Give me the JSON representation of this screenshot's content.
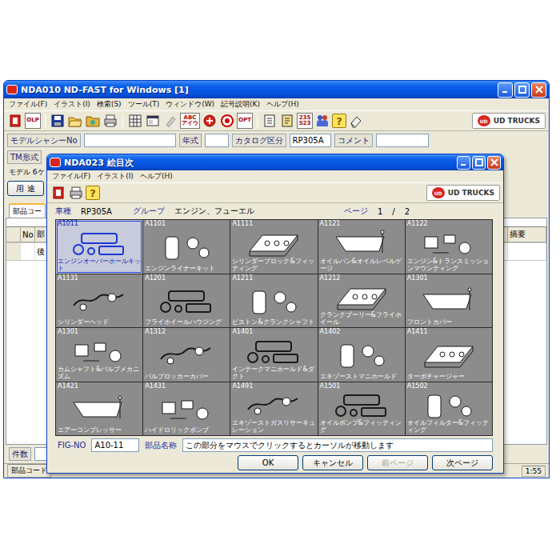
{
  "main_window": {
    "title": "NDA010 ND-FAST for Windows [1]",
    "menu": [
      "ファイル(F)",
      "イラスト(I)",
      "検索(S)",
      "ツール(T)",
      "ウィンドウ(W)",
      "記号説明(K)",
      "ヘルプ(H)"
    ],
    "toolbar": [
      {
        "kind": "icon"
      },
      {
        "kind": "text",
        "lines": [
          "OLP"
        ]
      },
      {
        "kind": "sep"
      },
      {
        "kind": "icon"
      },
      {
        "kind": "icon"
      },
      {
        "kind": "icon"
      },
      {
        "kind": "icon"
      },
      {
        "kind": "sep"
      },
      {
        "kind": "icon"
      },
      {
        "kind": "icon"
      },
      {
        "kind": "icon"
      },
      {
        "kind": "text",
        "lines": [
          "ABC",
          "アイウ"
        ]
      },
      {
        "kind": "icon"
      },
      {
        "kind": "icon"
      },
      {
        "kind": "text",
        "lines": [
          "OPT"
        ]
      },
      {
        "kind": "sep"
      },
      {
        "kind": "icon"
      },
      {
        "kind": "icon"
      },
      {
        "kind": "text",
        "lines": [
          "235",
          "523"
        ]
      },
      {
        "kind": "icon"
      },
      {
        "kind": "glyph",
        "lines": [
          "?"
        ]
      },
      {
        "kind": "icon"
      }
    ],
    "logo": {
      "mark": "UD",
      "text": "UD TRUCKS"
    },
    "fields": [
      {
        "label": "モデルシャシーNo",
        "value": ""
      },
      {
        "label": "年式",
        "value": ""
      },
      {
        "label": "カタログ区分",
        "value": "RP305A"
      },
      {
        "label": "コメント",
        "value": ""
      }
    ],
    "tm_label": "TM形式",
    "model_label": "モデル 6ケ",
    "use_button": "用 途",
    "tabs": [
      {
        "label": "部品コー",
        "selected": true
      }
    ],
    "table": {
      "columns": [
        "No",
        "部",
        "摘要"
      ],
      "rows": [
        [
          "",
          "後",
          ""
        ]
      ]
    },
    "count_label": "件数",
    "status_bar": {
      "left": "部品コード",
      "right": "1:55"
    }
  },
  "dialog": {
    "title": "NDA023 絵目次",
    "menu": [
      "ファイル(F)",
      "イラスト(I)",
      "ヘルプ(H)"
    ],
    "toolbar": [
      {
        "kind": "icon"
      },
      {
        "kind": "icon"
      },
      {
        "kind": "glyph",
        "lines": [
          "?"
        ]
      }
    ],
    "logo": {
      "mark": "UD",
      "text": "UD TRUCKS"
    },
    "info": {
      "model_label": "車種",
      "model": "RP305A",
      "group_label": "グループ",
      "group": "エンジン、フューエル",
      "page_label": "ページ",
      "page": "1",
      "separator": "/",
      "pages": "2"
    },
    "cells": [
      {
        "code": "A1011",
        "label": "エンジンオーバーホールキット",
        "selected": true
      },
      {
        "code": "A1101",
        "label": "エンジンライナーキット",
        "selected": false
      },
      {
        "code": "A1111",
        "label": "シリンダーブロック&フィッティング",
        "selected": false
      },
      {
        "code": "A1121",
        "label": "オイルパン&オイルレベルゲージ",
        "selected": false
      },
      {
        "code": "A1122",
        "label": "エンジン&トランスミッションマウンティング",
        "selected": false
      },
      {
        "code": "A1131",
        "label": "シリンダーヘッド",
        "selected": false
      },
      {
        "code": "A1201",
        "label": "フライホイールハウジング",
        "selected": false
      },
      {
        "code": "A1211",
        "label": "ピストン&クランクシャフト",
        "selected": false
      },
      {
        "code": "A1212",
        "label": "クランクプーリー&フライホイール",
        "selected": false
      },
      {
        "code": "A1301",
        "label": "フロントカバー",
        "selected": false
      },
      {
        "code": "A1301",
        "label": "カムシャフト&バルブメカニズム",
        "selected": false
      },
      {
        "code": "A1312",
        "label": "バルブロッカーカバー",
        "selected": false
      },
      {
        "code": "A1401",
        "label": "インテークマニホールド&ダクト",
        "selected": false
      },
      {
        "code": "A1402",
        "label": "エキゾーストマニホールド",
        "selected": false
      },
      {
        "code": "A1411",
        "label": "ターボチャージャー",
        "selected": false
      },
      {
        "code": "A1421",
        "label": "エアーコンプレッサー",
        "selected": false
      },
      {
        "code": "A1431",
        "label": "ハイドロリックポンプ",
        "selected": false
      },
      {
        "code": "A1491",
        "label": "エキゾーストガスリサーキュレーション",
        "selected": false
      },
      {
        "code": "A1501",
        "label": "オイルポンプ&フィッティング",
        "selected": false
      },
      {
        "code": "A1502",
        "label": "オイルフィルター&フィッティング",
        "selected": false
      }
    ],
    "fig_label": "FIG-NO",
    "fig_value": "A10-11",
    "name_label": "部品名称",
    "name_value": "この部分をマウスでクリックするとカーソルが移動します",
    "buttons": [
      {
        "label": "OK",
        "disabled": false
      },
      {
        "label": "キャンセル",
        "disabled": false
      },
      {
        "label": "前ページ",
        "disabled": true
      },
      {
        "label": "次ページ",
        "disabled": false
      }
    ]
  }
}
